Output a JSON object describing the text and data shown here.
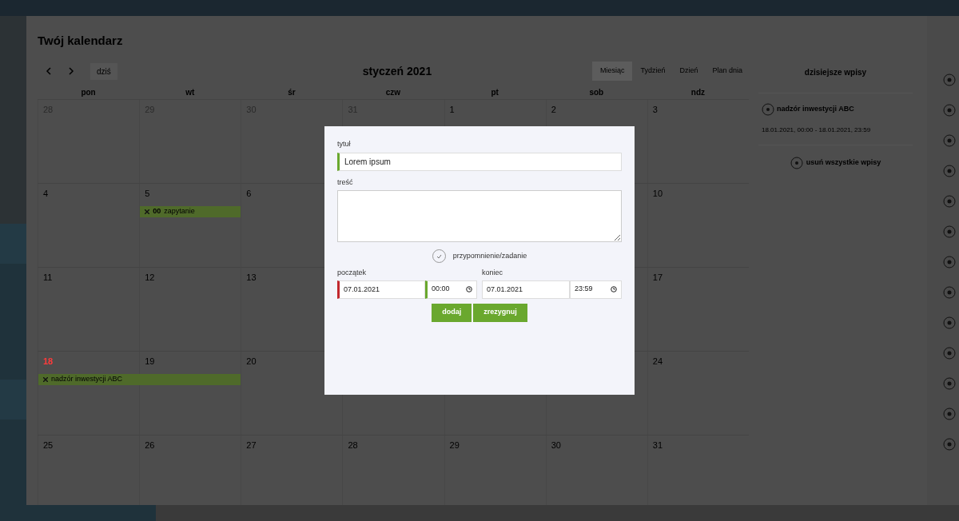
{
  "calendar": {
    "title": "Twój kalendarz",
    "today_button": "dziś",
    "month": "styczeń 2021",
    "views": [
      {
        "label": "Miesiąc",
        "selected": true
      },
      {
        "label": "Tydzień",
        "selected": false
      },
      {
        "label": "Dzień",
        "selected": false
      },
      {
        "label": "Plan dnia",
        "selected": false
      }
    ],
    "weekdays": [
      "pon",
      "wt",
      "śr",
      "czw",
      "pt",
      "sob",
      "ndz"
    ],
    "weeks": [
      {
        "days": [
          {
            "day": "28",
            "other_month": true,
            "today": false
          },
          {
            "day": "29",
            "other_month": true,
            "today": false
          },
          {
            "day": "30",
            "other_month": true,
            "today": false
          },
          {
            "day": "31",
            "other_month": true,
            "today": false
          },
          {
            "day": "1",
            "other_month": false,
            "today": false
          },
          {
            "day": "2",
            "other_month": false,
            "today": false
          },
          {
            "day": "3",
            "other_month": false,
            "today": false
          }
        ]
      },
      {
        "days": [
          {
            "day": "4",
            "other_month": false,
            "today": false
          },
          {
            "day": "5",
            "other_month": false,
            "today": false,
            "event": {
              "time": "00",
              "text": "zapytanie",
              "spans_next": false
            }
          },
          {
            "day": "6",
            "other_month": false,
            "today": false
          }
        ],
        "end_days": [
          {
            "day": "10",
            "other_month": false,
            "today": false
          }
        ]
      },
      {
        "days": [
          {
            "day": "11",
            "other_month": false,
            "today": false
          },
          {
            "day": "12",
            "other_month": false,
            "today": false
          },
          {
            "day": "13",
            "other_month": false,
            "today": false
          }
        ],
        "end_days": [
          {
            "day": "17",
            "other_month": false,
            "today": false
          }
        ]
      },
      {
        "days": [
          {
            "day": "18",
            "other_month": false,
            "today": true,
            "event": {
              "text": "nadzór inwestycji ABC",
              "spans_next": true
            }
          },
          {
            "day": "19",
            "other_month": false,
            "today": false
          },
          {
            "day": "20",
            "other_month": false,
            "today": false
          }
        ],
        "end_days": [
          {
            "day": "24",
            "other_month": false,
            "today": false
          }
        ]
      },
      {
        "days": [
          {
            "day": "25",
            "other_month": false,
            "today": false
          },
          {
            "day": "26",
            "other_month": false,
            "today": false
          },
          {
            "day": "27",
            "other_month": false,
            "today": false
          },
          {
            "day": "28",
            "other_month": false,
            "today": false
          },
          {
            "day": "29",
            "other_month": false,
            "today": false
          },
          {
            "day": "30",
            "other_month": false,
            "today": false
          },
          {
            "day": "31",
            "other_month": false,
            "today": false
          }
        ]
      }
    ]
  },
  "today_entries": {
    "title": "dzisiejsze wpisy",
    "entries": [
      {
        "title": "nadzór inwestycji ABC",
        "range": "18.01.2021, 00:00 - 18.01.2021, 23:59"
      }
    ],
    "clear_all": "usuń wszystkie wpisy"
  },
  "dialog": {
    "title_field": {
      "label": "tytuł",
      "value": "Lorem ipsum",
      "invalid": false
    },
    "content_field": {
      "label": "treść"
    },
    "reminder": {
      "label": "przypomnienie/zadanie",
      "checked": false
    },
    "start": {
      "label": "początek",
      "date": "07.01.2021",
      "date_invalid": true,
      "time": "00:00",
      "time_invalid": false
    },
    "end": {
      "label": "koniec",
      "date": "07.01.2021",
      "time": "23:59"
    },
    "buttons": [
      "dodaj",
      "zrezygnuj"
    ]
  }
}
